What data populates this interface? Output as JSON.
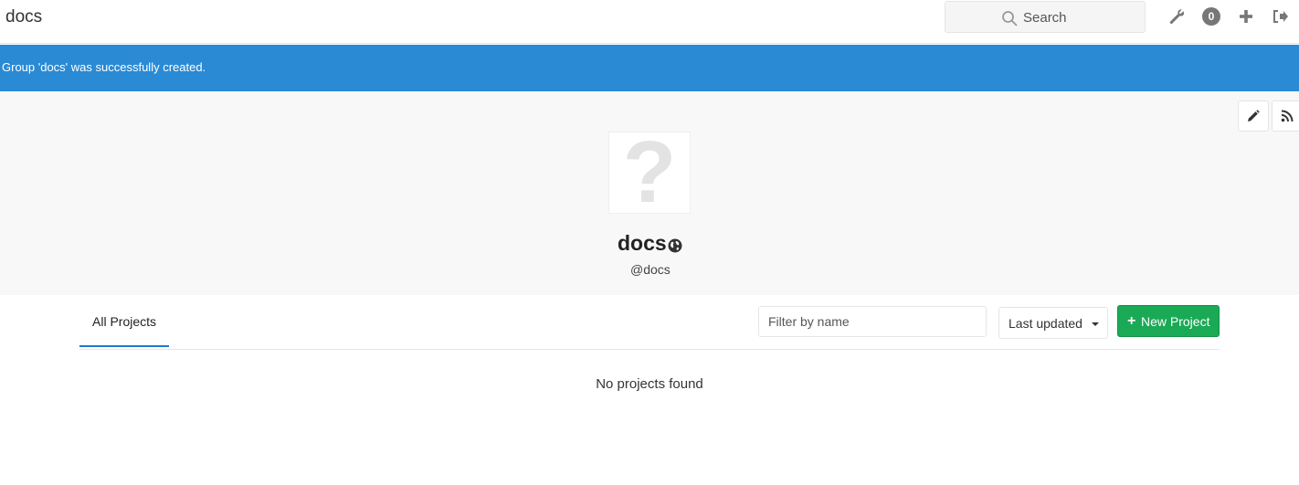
{
  "header": {
    "title": "docs",
    "search_placeholder": "Search",
    "notification_count": "0"
  },
  "flash": {
    "message": "Group 'docs' was successfully created."
  },
  "group": {
    "avatar_glyph": "?",
    "name": "docs",
    "handle": "@docs"
  },
  "tabs": {
    "all_projects": "All Projects"
  },
  "controls": {
    "filter_placeholder": "Filter by name",
    "sort_label": "Last updated",
    "new_project_label": "New Project"
  },
  "empty_state": "No projects found",
  "colors": {
    "flash_bg": "#2a8ad4",
    "primary_button": "#1aaa55",
    "active_tab": "#1f78d1"
  },
  "icons": [
    "search-icon",
    "wrench-icon",
    "plus-icon",
    "sign-out-icon",
    "pencil-icon",
    "rss-icon",
    "globe-icon"
  ]
}
